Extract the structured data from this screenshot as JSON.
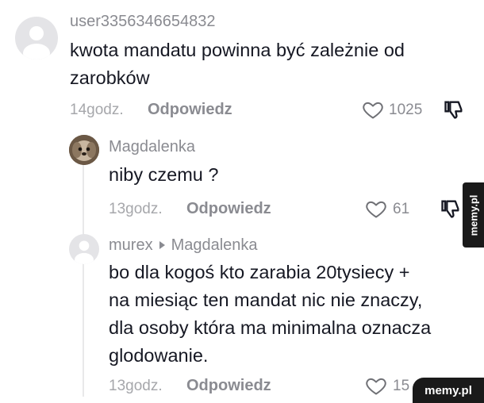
{
  "comments": [
    {
      "username": "user3356346654832",
      "lines": [
        "kwota mandatu powinna być zależnie od",
        "zarobków"
      ],
      "time": "14godz.",
      "reply_label": "Odpowiedz",
      "likes": "1025",
      "avatar": "default-avatar-icon"
    },
    {
      "username": "Magdalenka",
      "lines": [
        "niby czemu ?"
      ],
      "time": "13godz.",
      "reply_label": "Odpowiedz",
      "likes": "61",
      "avatar": "dog-photo-avatar"
    },
    {
      "username": "murex",
      "reply_to": "Magdalenka",
      "lines": [
        "bo dla kogoś kto zarabia 20tysiecy +",
        "na miesiąc ten mandat nic nie znaczy,",
        "dla osoby która ma minimalna oznacza",
        "glodowanie."
      ],
      "time": "13godz.",
      "reply_label": "Odpowiedz",
      "likes": "15",
      "avatar": "default-avatar-icon"
    }
  ],
  "watermark": {
    "side": "memy.pl",
    "bottom": "memy.pl"
  },
  "colors": {
    "muted": "#8a8b91",
    "text": "#161823",
    "thread_line": "#e9e9ea"
  }
}
